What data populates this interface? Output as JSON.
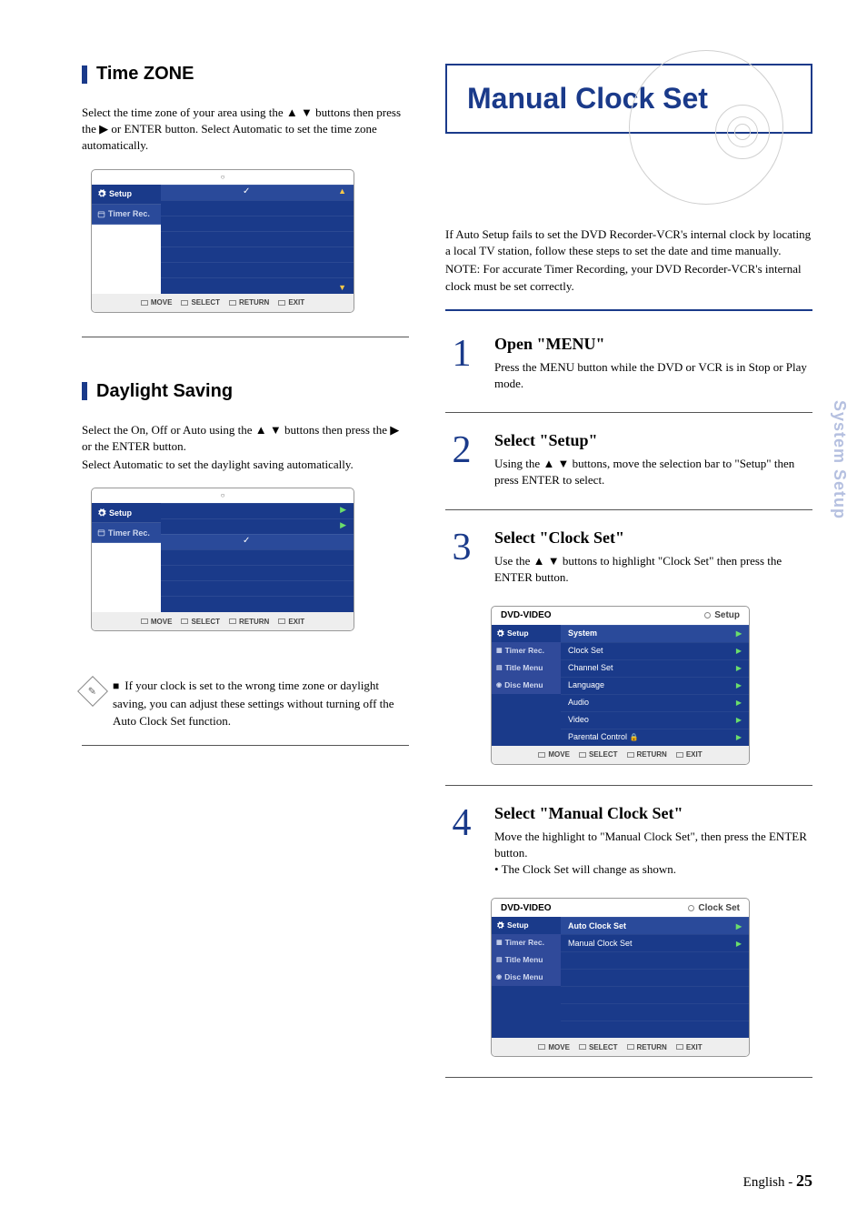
{
  "side_tab": "System Setup",
  "footer": {
    "lang": "English -",
    "page": "25"
  },
  "left": {
    "timezone": {
      "title": "Time ZONE",
      "body": "Select the time zone of your area using the ▲ ▼ buttons then press the ▶ or ENTER button. Select Automatic to set the time zone automatically."
    },
    "daylight": {
      "title": "Daylight Saving",
      "body1": "Select the On, Off or Auto using the ▲ ▼ buttons then press the ▶ or the ENTER button.",
      "body2": "Select Automatic to set the daylight saving automatically."
    },
    "note": {
      "bullet": "■",
      "text": "If your clock is set to the wrong time zone or daylight saving, you can adjust these settings without turning off the Auto Clock Set function."
    }
  },
  "right": {
    "title": "Manual Clock Set",
    "intro1": "If Auto Setup fails to set the DVD Recorder-VCR's internal clock by locating a local TV station, follow these steps to set the date and time manually.",
    "intro2": "NOTE: For accurate Timer Recording, your DVD Recorder-VCR's internal clock must be set correctly.",
    "steps": [
      {
        "n": "1",
        "h": "Open \"MENU\"",
        "p": "Press the MENU button while the DVD or VCR is in Stop or Play mode."
      },
      {
        "n": "2",
        "h": "Select \"Setup\"",
        "p": "Using the ▲ ▼ buttons, move the selection bar to \"Setup\" then press ENTER to select."
      },
      {
        "n": "3",
        "h": "Select \"Clock Set\"",
        "p": "Use the ▲ ▼ buttons to highlight \"Clock Set\" then press the ENTER button."
      },
      {
        "n": "4",
        "h": "Select \"Manual Clock Set\"",
        "p": "Move the highlight to \"Manual Clock Set\", then press the ENTER button.",
        "p2": "• The Clock Set will change as shown."
      }
    ]
  },
  "osd": {
    "sidebar": {
      "setup": "Setup",
      "timer": "Timer Rec.",
      "title_menu": "Title Menu",
      "disc_menu": "Disc Menu"
    },
    "footer": {
      "move": "MOVE",
      "select": "SELECT",
      "return": "RETURN",
      "exit": "EXIT"
    },
    "screen3": {
      "header_l": "DVD-VIDEO",
      "header_r": "Setup",
      "items": [
        "System",
        "Clock Set",
        "Channel Set",
        "Language",
        "Audio",
        "Video",
        "Parental Control"
      ]
    },
    "screen4": {
      "header_l": "DVD-VIDEO",
      "header_r": "Clock Set",
      "items": [
        "Auto Clock Set",
        "Manual Clock Set"
      ]
    }
  }
}
